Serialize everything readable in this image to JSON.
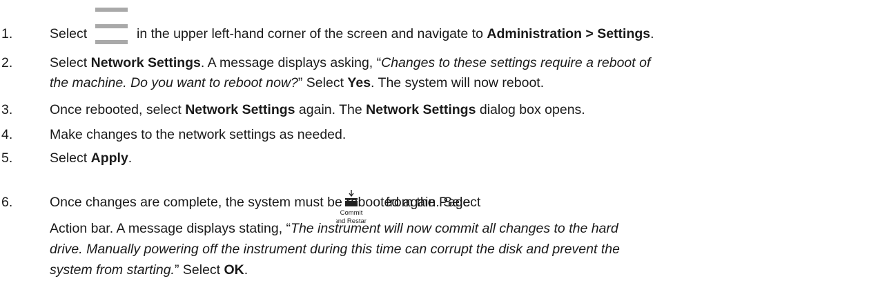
{
  "steps": [
    {
      "number": "1.",
      "text_a": "Select",
      "icon": "hamburger-menu-icon",
      "text_b": "in the upper left-hand corner of the screen and navigate to",
      "bold_a": "Administration > Settings",
      "text_c": "."
    },
    {
      "number": "2.",
      "text_a": "Select",
      "bold_a": "Network Settings",
      "text_b": ". A message displays asking, “",
      "italic_a": "Changes to these settings require a reboot of",
      "italic_b": "the machine. Do you want to reboot now?",
      "text_c": "” Select",
      "bold_b": "Yes",
      "text_d": ". The system will now reboot."
    },
    {
      "number": "3.",
      "text_a": "Once rebooted, select",
      "bold_a": "Network Settings",
      "text_b": "again. The",
      "bold_b": "Network Settings",
      "text_c": "dialog box opens."
    },
    {
      "number": "4.",
      "text_a": "Make changes to the network settings as needed."
    },
    {
      "number": "5.",
      "text_a": "Select",
      "bold_a": "Apply",
      "text_b": "."
    },
    {
      "number": "6.",
      "text_a": "Once changes are complete, the system must be rebooted again. Select",
      "icon": "commit-and-restart-icon",
      "icon_label_a": "Commit",
      "icon_label_b": "and Restart",
      "text_b": "from the Page",
      "text_c": "Action bar. A message displays stating, “",
      "italic_a": "The instrument will now commit all changes to the hard",
      "italic_b": "drive. Manually powering off the instrument during this time can corrupt the disk and prevent the",
      "italic_c": "system from starting.",
      "text_d": "” Select",
      "bold_a": "OK",
      "text_e": "."
    }
  ]
}
